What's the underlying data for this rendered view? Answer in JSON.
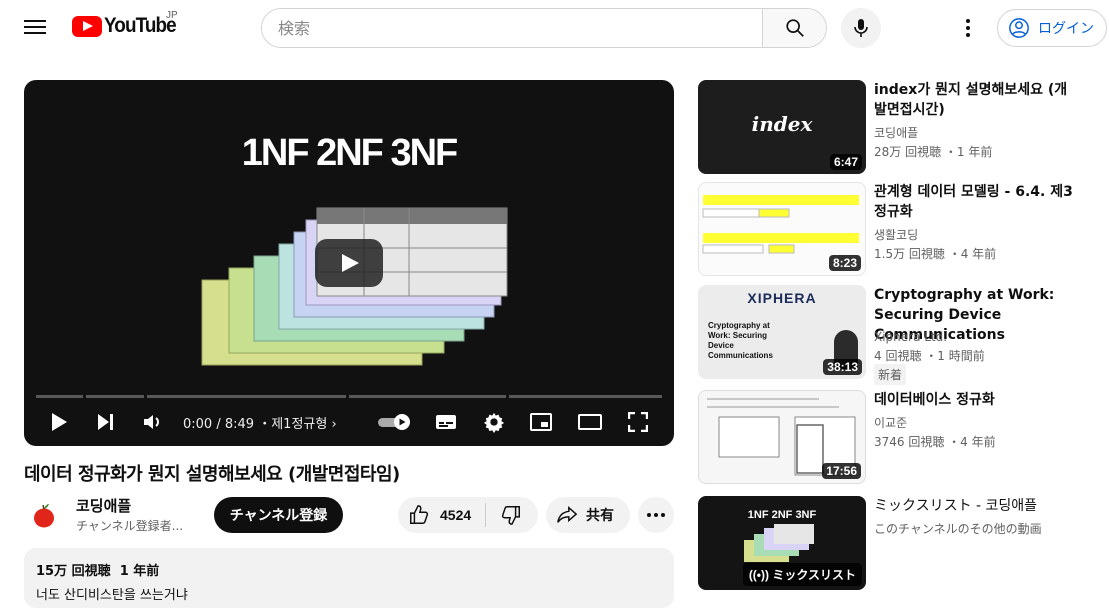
{
  "header": {
    "logo_text": "YouTube",
    "logo_region": "JP",
    "search_placeholder": "検索",
    "login_label": "ログイン"
  },
  "player": {
    "video_overlay_title": "1NF 2NF 3NF",
    "current_time": "0:00",
    "duration": "8:49",
    "chapter": "제1정규형",
    "progress_fraction": 0.0
  },
  "video": {
    "title": "데이터 정규화가 뭔지 설명해보세요 (개발면접타임)",
    "channel_name": "코딩애플",
    "channel_subs": "チャンネル登録者...",
    "subscribe_label": "チャンネル登録",
    "likes": "4524",
    "share_label": "共有",
    "views": "15万 回視聴",
    "age": "1 年前",
    "description": "너도 산디비스탄을 쓰는거냐"
  },
  "recommendations": [
    {
      "title": "index가 뭔지 설명해보세요 (개발면접시간)",
      "channel": "코딩애플",
      "meta": "28万 回視聴 ・1 年前",
      "duration": "6:47",
      "thumb_text": "index"
    },
    {
      "title": "관계형 데이터 모델링 - 6.4. 제3 정규화",
      "channel": "생활코딩",
      "meta": "1.5万 回視聴 ・4 年前",
      "duration": "8:23"
    },
    {
      "title": "Cryptography at Work: Securing Device Communications",
      "channel": "Xiphera Ltd.",
      "meta": "4 回視聴 ・1 時間前",
      "duration": "38:13",
      "badge": "新着",
      "thumb_brand": "XIPHERA",
      "thumb_text": "Cryptography at Work: Securing Device Communications"
    },
    {
      "title": "데이터베이스 정규화",
      "channel": "이교준",
      "meta": "3746 回視聴 ・4 年前",
      "duration": "17:56"
    },
    {
      "title": "ミックスリスト - 코딩애플",
      "channel": "このチャンネルのその他の動画",
      "thumb_text": "1NF 2NF 3NF",
      "mix_label": "ミックスリスト"
    }
  ]
}
